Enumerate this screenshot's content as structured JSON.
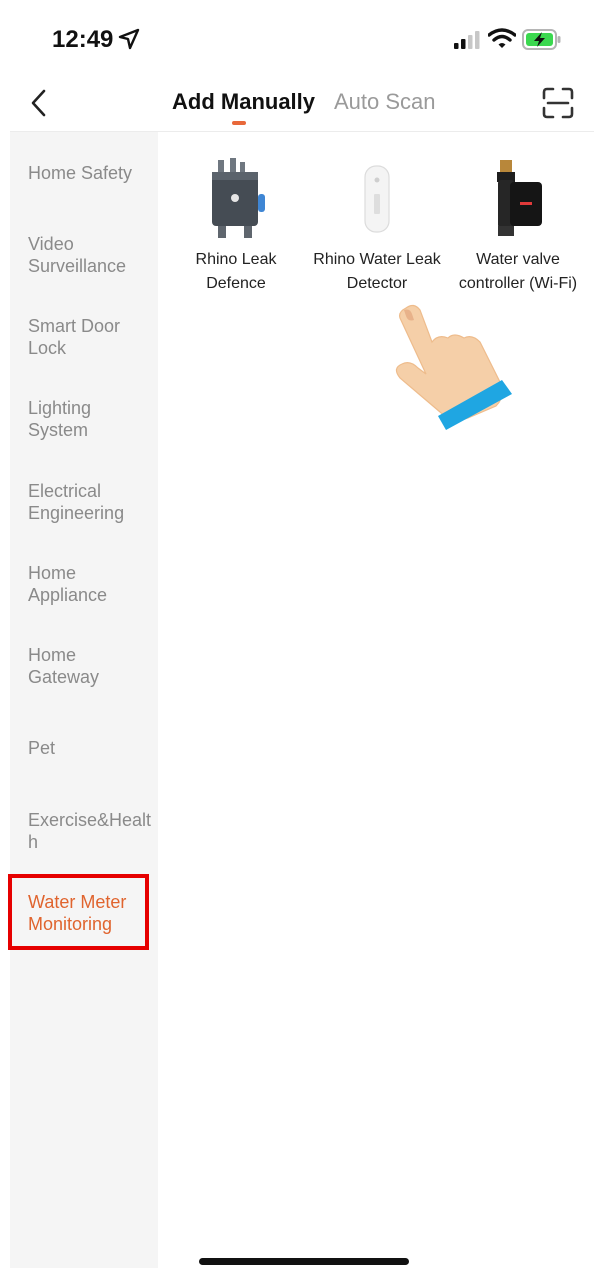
{
  "status_bar": {
    "time": "12:49"
  },
  "nav": {
    "tabs": [
      {
        "label": "Add Manually",
        "active": true
      },
      {
        "label": "Auto Scan",
        "active": false
      }
    ],
    "accent_color": "#e8683a"
  },
  "sidebar": {
    "items": [
      {
        "label": "Home Safety"
      },
      {
        "label": "Video Surveillance"
      },
      {
        "label": "Smart Door Lock"
      },
      {
        "label": "Lighting System"
      },
      {
        "label": "Electrical Engineering"
      },
      {
        "label": "Home Appliance"
      },
      {
        "label": "Home Gateway"
      },
      {
        "label": "Pet"
      },
      {
        "label": "Exercise&Health"
      },
      {
        "label": "Water Meter Monitoring",
        "selected": true
      }
    ],
    "highlight_color": "#e60000"
  },
  "products": [
    {
      "name": "Rhino Leak Defence"
    },
    {
      "name": "Rhino Water Leak Detector"
    },
    {
      "name": "Water valve controller (Wi-Fi)"
    }
  ]
}
